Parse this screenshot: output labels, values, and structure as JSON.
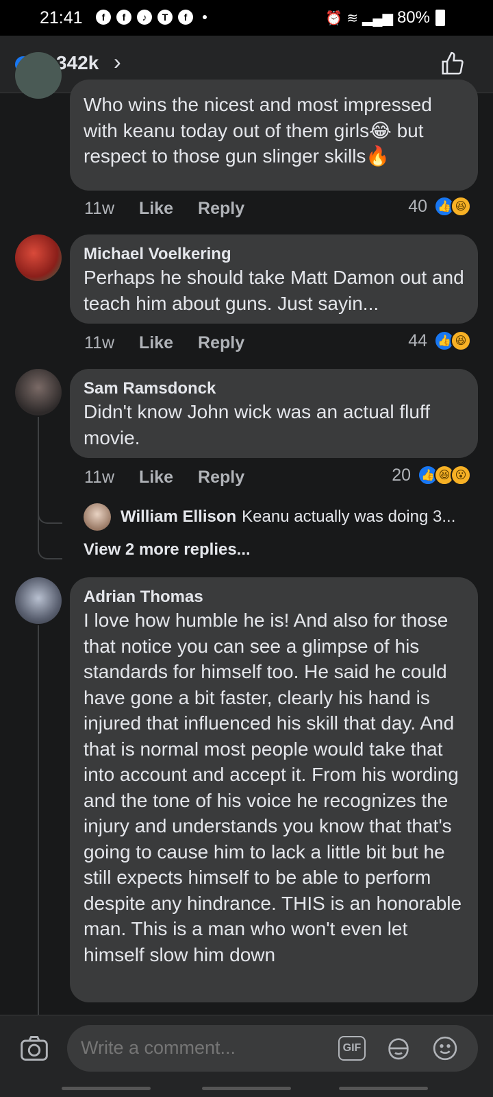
{
  "status_bar": {
    "time": "21:41",
    "battery": "80%"
  },
  "header": {
    "reaction_count": "342k"
  },
  "comments": [
    {
      "text_partial": "Who wins the nicest and most impressed with keanu today out of them girls😂 but respect to those gun slinger skills🔥",
      "time": "11w",
      "like": "Like",
      "reply": "Reply",
      "reaction_count": "40"
    },
    {
      "author": "Michael Voelkering",
      "text": "Perhaps he should take Matt Damon out and teach him about guns.  Just sayin...",
      "time": "11w",
      "like": "Like",
      "reply": "Reply",
      "reaction_count": "44"
    },
    {
      "author": "Sam Ramsdonck",
      "text": "Didn't know John wick was an actual fluff movie.",
      "time": "11w",
      "like": "Like",
      "reply": "Reply",
      "reaction_count": "20",
      "reply_preview": {
        "author": "William Ellison",
        "text": "Keanu actually was doing 3..."
      },
      "view_more": "View 2 more replies..."
    },
    {
      "author": "Adrian Thomas",
      "text": "I love how humble he is! And also for those that notice you can see a glimpse of his standards for himself too. He said he could have gone a bit faster, clearly his hand is injured that influenced his skill that day. And that is normal most people would take that into account and accept it. From his wording and the tone of his voice he recognizes the injury and understands you know that that's going to cause him to lack a little bit but he still expects himself to be able to perform despite any hindrance. THIS is an honorable man. This is a man who won't even let himself slow him down"
    }
  ],
  "composer": {
    "placeholder": "Write a comment...",
    "gif_label": "GIF"
  }
}
